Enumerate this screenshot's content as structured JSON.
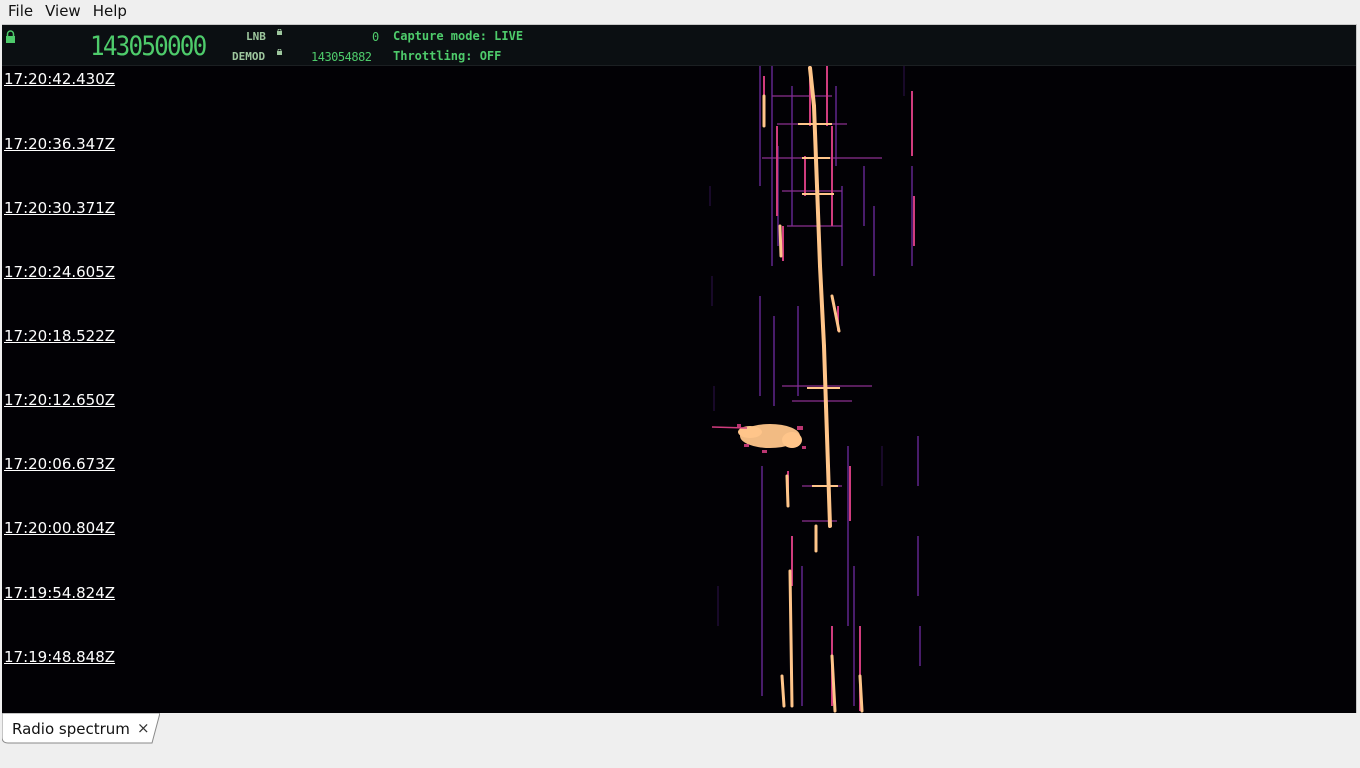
{
  "menubar": {
    "file": "File",
    "view": "View",
    "help": "Help"
  },
  "status": {
    "frequency": "143050000",
    "lnb_label": "LNB",
    "lnb_value": "0",
    "demod_label": "DEMOD",
    "demod_value": "143054882",
    "capture_mode": "Capture mode: LIVE",
    "throttling": "Throttling: OFF"
  },
  "waterfall": {
    "timestamps": [
      "17:20:42.430Z",
      "17:20:36.347Z",
      "17:20:30.371Z",
      "17:20:24.605Z",
      "17:20:18.522Z",
      "17:20:12.650Z",
      "17:20:06.673Z",
      "17:20:00.804Z",
      "17:19:54.824Z",
      "17:19:48.848Z"
    ]
  },
  "tabs": {
    "active_label": "Radio spectrum",
    "close_glyph": "×"
  },
  "colors": {
    "display_green": "#4ecb6b",
    "waterfall_bg": "#020105",
    "signal_hot": "#ffc58a",
    "signal_mid": "#c8327a",
    "signal_low": "#5a1a8a"
  },
  "icons": {
    "lock": "lock-icon",
    "close": "close-icon"
  }
}
